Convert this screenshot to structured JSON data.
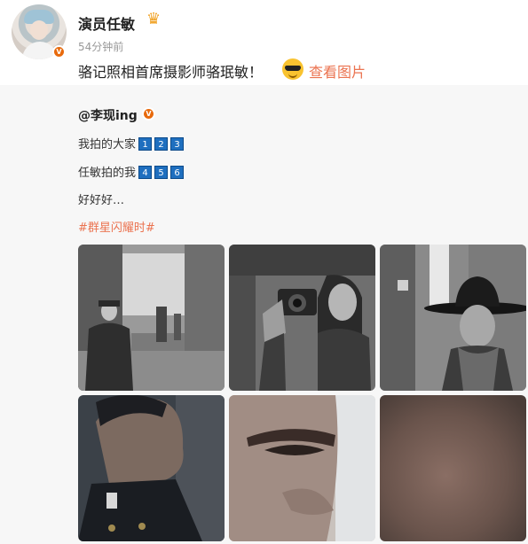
{
  "post": {
    "username": "演员任敏",
    "timestamp": "54分钟前",
    "text": "骆记照相首席摄影师骆珉敏！",
    "view_images_label": "查看图片"
  },
  "repost": {
    "author": "@李现ing",
    "line1": "我拍的大家",
    "line1_nums": [
      "1",
      "2",
      "3"
    ],
    "line2": "任敏拍的我",
    "line2_nums": [
      "4",
      "5",
      "6"
    ],
    "line3": "好好好…",
    "hashtag": "#群星闪耀时#"
  },
  "photos": [
    {
      "subject": "man-in-alley-street-photo"
    },
    {
      "subject": "woman-with-camera-photo"
    },
    {
      "subject": "man-in-black-hat-photo"
    },
    {
      "subject": "man-profile-uniform-photo"
    },
    {
      "subject": "eye-closeup-photo"
    },
    {
      "subject": "blurred-skin-closeup-photo"
    }
  ],
  "colors": {
    "link": "#eb7350",
    "badge": "#e86a0c",
    "number_box": "#1f6fbf"
  }
}
